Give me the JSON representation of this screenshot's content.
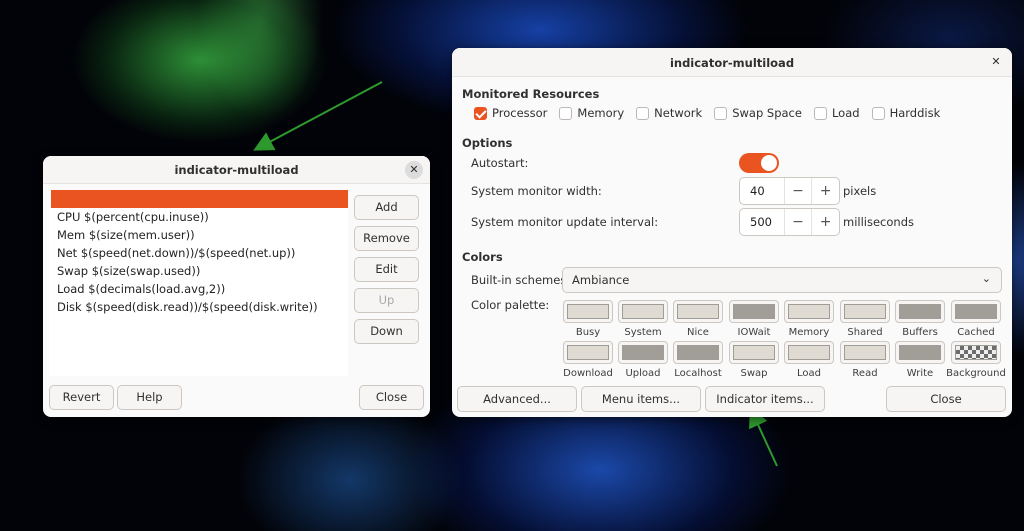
{
  "left_window": {
    "title": "indicator-multiload",
    "close_glyph": "✕",
    "items": [
      "",
      "CPU $(percent(cpu.inuse))",
      "Mem $(size(mem.user))",
      "Net $(speed(net.down))/$(speed(net.up))",
      "Swap $(size(swap.used))",
      "Load $(decimals(load.avg,2))",
      "Disk $(speed(disk.read))/$(speed(disk.write))"
    ],
    "buttons": {
      "add": "Add",
      "remove": "Remove",
      "edit": "Edit",
      "up": "Up",
      "down": "Down"
    },
    "footer": {
      "revert": "Revert",
      "help": "Help",
      "close": "Close"
    }
  },
  "right_window": {
    "title": "indicator-multiload",
    "close_glyph": "✕",
    "monitored_heading": "Monitored Resources",
    "resources": [
      {
        "label": "Processor",
        "checked": true
      },
      {
        "label": "Memory",
        "checked": false
      },
      {
        "label": "Network",
        "checked": false
      },
      {
        "label": "Swap Space",
        "checked": false
      },
      {
        "label": "Load",
        "checked": false
      },
      {
        "label": "Harddisk",
        "checked": false
      }
    ],
    "options_heading": "Options",
    "autostart_label": "Autostart:",
    "autostart_on": true,
    "width_label": "System monitor width:",
    "width_value": "40",
    "width_unit": "pixels",
    "interval_label": "System monitor update interval:",
    "interval_value": "500",
    "interval_unit": "milliseconds",
    "minus_glyph": "−",
    "plus_glyph": "+",
    "colors_heading": "Colors",
    "schemes_label": "Built-in schemes:",
    "scheme_value": "Ambiance",
    "chevron_glyph": "⌄",
    "palette_label": "Color palette:",
    "palette_row1": [
      {
        "label": "Busy",
        "color": "#dfdbd2"
      },
      {
        "label": "System",
        "color": "#dfdbd2"
      },
      {
        "label": "Nice",
        "color": "#dfdbd2"
      },
      {
        "label": "IOWait",
        "color": "#a19e97"
      },
      {
        "label": "Memory",
        "color": "#dfdbd2"
      },
      {
        "label": "Shared",
        "color": "#dfdbd2"
      },
      {
        "label": "Buffers",
        "color": "#a19e97"
      },
      {
        "label": "Cached",
        "color": "#a19e97"
      }
    ],
    "palette_row2": [
      {
        "label": "Download",
        "color": "#dfdbd2"
      },
      {
        "label": "Upload",
        "color": "#a19e97"
      },
      {
        "label": "Localhost",
        "color": "#a19e97"
      },
      {
        "label": "Swap",
        "color": "#dfdbd2"
      },
      {
        "label": "Load",
        "color": "#dfdbd2"
      },
      {
        "label": "Read",
        "color": "#dfdbd2"
      },
      {
        "label": "Write",
        "color": "#a19e97"
      },
      {
        "label": "Background",
        "color": "checker"
      }
    ],
    "footer": {
      "advanced": "Advanced...",
      "menu_items": "Menu items...",
      "indicator_items": "Indicator items...",
      "close": "Close"
    }
  },
  "colors": {
    "accent": "#e95420",
    "arrow": "#2e9a2e"
  }
}
